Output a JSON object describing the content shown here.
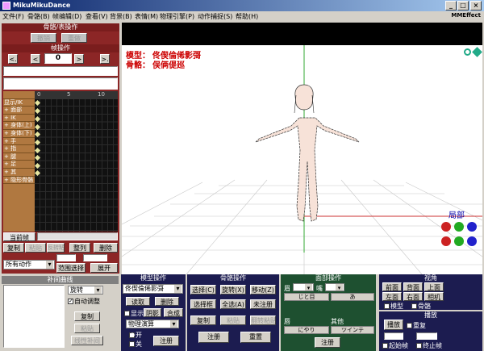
{
  "window": {
    "title": "MikuMikuDance",
    "min": "_",
    "max": "□",
    "close": "×"
  },
  "menu": [
    "文件(F)",
    "骨骼(B)",
    "帧编辑(D)",
    "查看(V)",
    "背景(B)",
    "表情(M)",
    "物理引擎(P)",
    "动作捕捉(S)",
    "帮助(H)"
  ],
  "menu_right": "MMEffect",
  "left": {
    "bone_ops_title": "骨骼/表操作",
    "undo": "撤销",
    "redo": "重做",
    "frame_ops_title": "帧操作",
    "prev": "<",
    "next": ">",
    "prev_key": "<.",
    "next_key": ">.",
    "frame_value": "0",
    "ruler": [
      "0",
      "5",
      "10"
    ],
    "tracks": [
      "",
      "显示/IK",
      "+ 面部",
      "+ IK",
      "+ 身体(上)",
      "+ 身体(下)",
      "+ 手",
      "+ 指",
      "+ 腿",
      "+ 足",
      "+ 其",
      "+ 隐形骨骼"
    ],
    "current_frame": "当前帧",
    "copy": "复制",
    "paste": "粘贴",
    "reverse_paste": "反转粘贴",
    "organize": "整列",
    "delete": "删除",
    "all_actions": "所有动作",
    "range_select": "范围选择",
    "expand": "展开"
  },
  "viewport": {
    "model_label": "模型：",
    "model_value": "佟偰倫俙影彁",
    "bone_label": "骨骼：",
    "bone_value": "俣俩偍廵",
    "local_label": "局部"
  },
  "interp": {
    "title": "补间曲线",
    "rotate": "旋转",
    "auto_adjust": "自动调整",
    "copy": "复制",
    "paste": "粘贴",
    "linear": "线性补间"
  },
  "model_ops": {
    "title": "模型操作",
    "model_select": "佟偰倫俙影彁",
    "load": "读取",
    "delete": "删除",
    "show": "显示",
    "shadow": "阴影",
    "add": "合成",
    "physics": "物理演算",
    "on": "开",
    "off": "关",
    "register": "注册"
  },
  "bone_ops": {
    "title": "骨骼操作",
    "select": "选择(C)",
    "rotate": "旋转(X)",
    "move": "移动(Z)",
    "box_select": "选择框",
    "select_all": "全选(A)",
    "unregistered": "未注册",
    "copy": "复制",
    "paste": "粘贴",
    "reverse_paste": "翻转粘贴",
    "register": "注册",
    "reset": "重置"
  },
  "face_ops": {
    "title": "面部操作",
    "eyebrow": "眉",
    "eyes": "眼",
    "mouth": "嘴",
    "eyebrow_val": "じと目",
    "mouth_val": "あ",
    "lip": "唇",
    "other": "其他",
    "lip_val": "にやり",
    "other_val": "ツインテ",
    "register": "注册"
  },
  "view": {
    "title": "视角",
    "front": "前面",
    "back": "背面",
    "top": "上面",
    "left": "左面",
    "right": "右面",
    "camera": "相机",
    "model": "模型",
    "bone": "骨骼"
  },
  "play": {
    "title": "播放",
    "play": "播放",
    "repeat": "重复",
    "from": "起始帧",
    "to": "终止帧"
  }
}
